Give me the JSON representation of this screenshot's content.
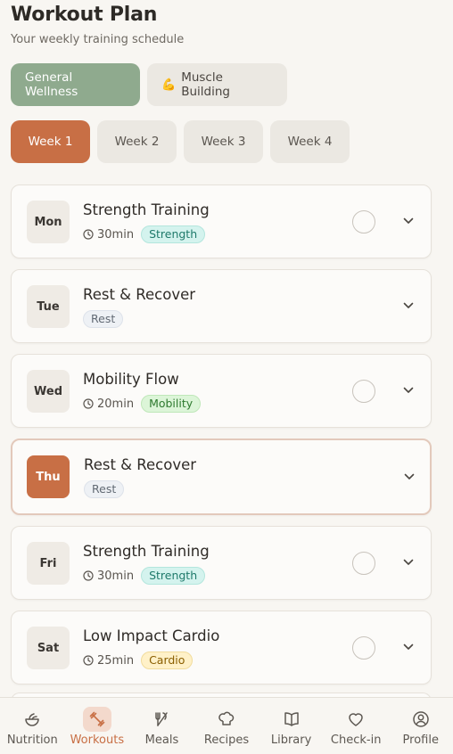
{
  "header": {
    "title": "Workout Plan",
    "subtitle": "Your weekly training schedule"
  },
  "plan_tabs": [
    {
      "label": "General Wellness",
      "emoji": "",
      "active": true
    },
    {
      "label": "Muscle Building",
      "emoji": "💪",
      "active": false
    }
  ],
  "week_tabs": [
    {
      "label": "Week 1",
      "active": true
    },
    {
      "label": "Week 2",
      "active": false
    },
    {
      "label": "Week 3",
      "active": false
    },
    {
      "label": "Week 4",
      "active": false
    }
  ],
  "days": [
    {
      "day": "Mon",
      "title": "Strength Training",
      "duration": "30min",
      "tag": "Strength",
      "tag_type": "strength",
      "completable": true,
      "today": false
    },
    {
      "day": "Tue",
      "title": "Rest & Recover",
      "duration": "",
      "tag": "Rest",
      "tag_type": "rest",
      "completable": false,
      "today": false
    },
    {
      "day": "Wed",
      "title": "Mobility Flow",
      "duration": "20min",
      "tag": "Mobility",
      "tag_type": "mobility",
      "completable": true,
      "today": false
    },
    {
      "day": "Thu",
      "title": "Rest & Recover",
      "duration": "",
      "tag": "Rest",
      "tag_type": "rest",
      "completable": false,
      "today": true
    },
    {
      "day": "Fri",
      "title": "Strength Training",
      "duration": "30min",
      "tag": "Strength",
      "tag_type": "strength",
      "completable": true,
      "today": false
    },
    {
      "day": "Sat",
      "title": "Low Impact Cardio",
      "duration": "25min",
      "tag": "Cardio",
      "tag_type": "cardio",
      "completable": true,
      "today": false
    }
  ],
  "nav": [
    {
      "label": "Nutrition",
      "icon": "salad-bowl-icon",
      "active": false
    },
    {
      "label": "Workouts",
      "icon": "dumbbell-icon",
      "active": true
    },
    {
      "label": "Meals",
      "icon": "utensils-icon",
      "active": false
    },
    {
      "label": "Recipes",
      "icon": "chef-hat-icon",
      "active": false
    },
    {
      "label": "Library",
      "icon": "book-icon",
      "active": false
    },
    {
      "label": "Check-in",
      "icon": "heart-icon",
      "active": false
    },
    {
      "label": "Profile",
      "icon": "user-circle-icon",
      "active": false
    }
  ],
  "colors": {
    "accent": "#c86f45",
    "plan_active": "#8faa8e",
    "background": "#f8f6f2"
  }
}
